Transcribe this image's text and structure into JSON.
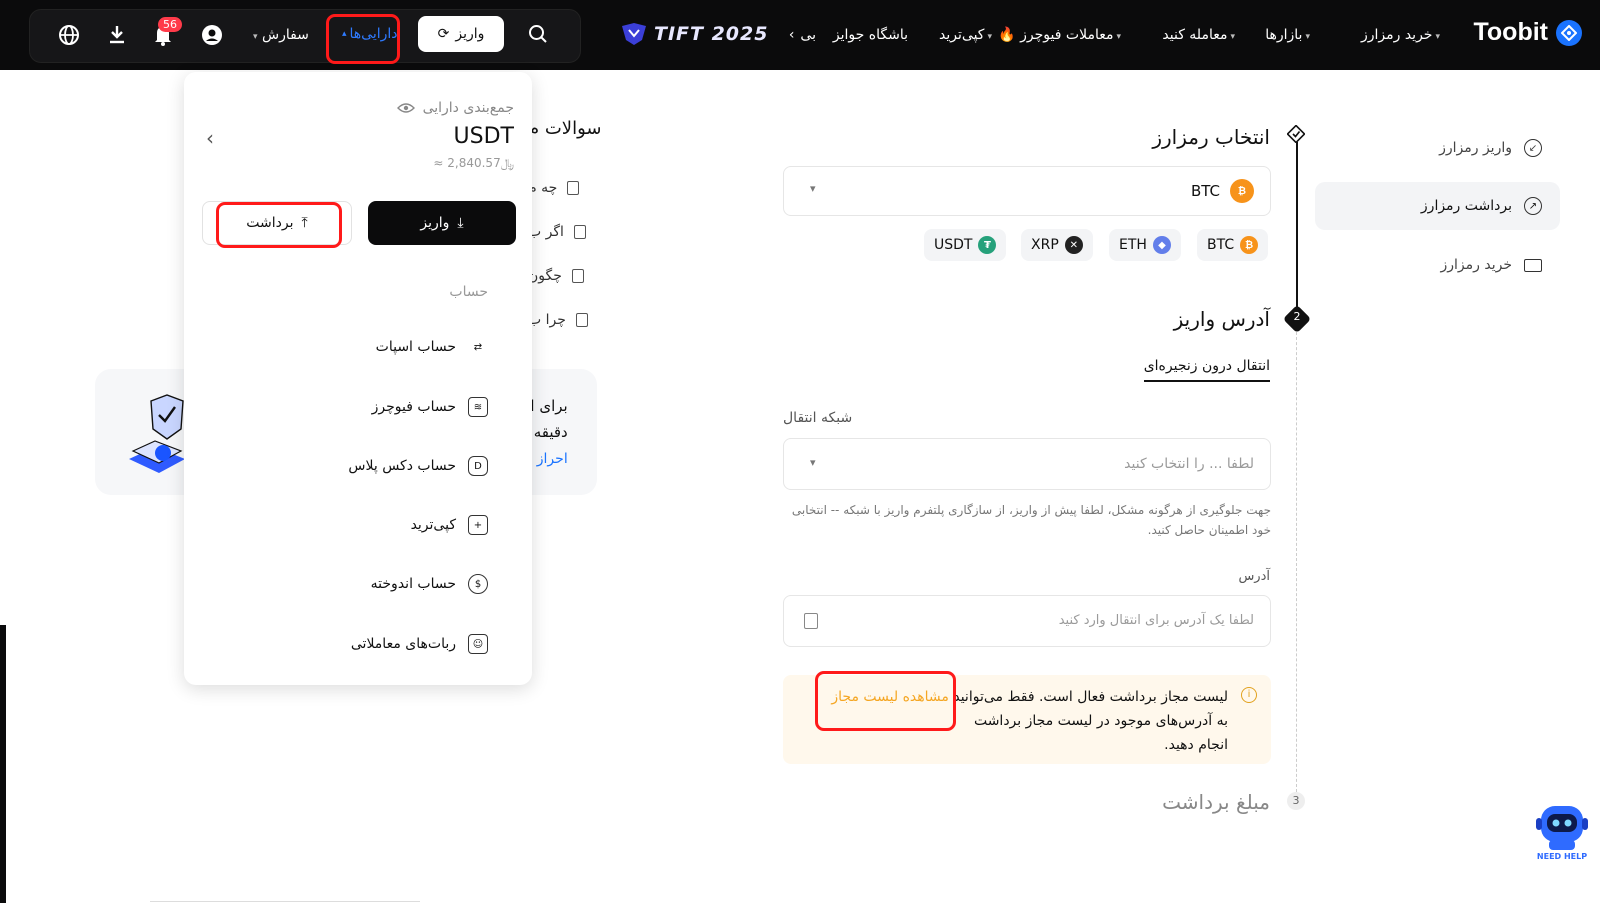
{
  "header": {
    "brand": "Toobit",
    "nav": [
      "خرید رمزارز",
      "بازارها",
      "معامله کنید",
      "معاملات فیوچرز",
      "کپی‌ترید",
      "باشگاه جوایز",
      "بی"
    ],
    "promo": "TIFT 2025",
    "deposit_label": "واریز",
    "assets_label": "دارایی‌ها",
    "orders_label": "سفارش",
    "notifications_count": "56"
  },
  "sidebar": {
    "items": [
      {
        "label": "واریز رمزارز",
        "active": false
      },
      {
        "label": "برداشت رمزارز",
        "active": true
      },
      {
        "label": "خرید رمزارز",
        "active": false
      }
    ]
  },
  "main": {
    "step1_title": "انتخاب رمزارز",
    "selected_coin": "BTC",
    "coin_options": [
      "BTC",
      "ETH",
      "XRP",
      "USDT"
    ],
    "step2_num": "2",
    "step2_title": "آدرس واریز",
    "tab_label": "انتقال درون زنجیره‌ای",
    "network_label": "شبکه انتقال",
    "network_placeholder": "لطفا ... را انتخاب کنید",
    "network_hint": "جهت جلوگیری از هرگونه مشکل، لطفا پیش از واریز، از سازگاری پلتفرم واریز با شبکه -- انتخابی خود اطمینان حاصل کنید.",
    "address_label": "آدرس",
    "address_placeholder": "لطفا یک آدرس برای انتقال وارد کنید",
    "warning_text_1": "لیست مجاز برداشت فعال است. فقط می‌توانید",
    "warning_link": "مشاهده لیست مجاز",
    "warning_text_2": "به آدرس‌های موجود در لیست مجاز برداشت",
    "warning_text_3": "انجام دهید.",
    "step3_num": "3",
    "step3_title": "مبلغ برداشت"
  },
  "faq": {
    "title": "سوالات م",
    "items": [
      "چه م",
      "اگر ب",
      "چگون",
      "چرا ب"
    ],
    "promo_line1": "برای ا",
    "promo_line2": "دقیقه",
    "promo_link": "احراز ه"
  },
  "dropdown": {
    "summary_label": "جمع‌بندی دارایی",
    "balance": "USDT",
    "balance_fiat": "≈ ﷼2,840.57",
    "deposit_btn": "واریز",
    "withdraw_btn": "برداشت",
    "section_label": "حساب",
    "accounts": [
      "حساب اسپات",
      "حساب فیوچرز",
      "حساب دکس پلاس",
      "کپی‌ترید",
      "حساب اندوخته",
      "ربات‌های معاملاتی"
    ]
  },
  "help_bot": "NEED HELP",
  "colors": {
    "accent": "#1a73ff",
    "red": "#ff1a1a",
    "btc": "#f7931a",
    "usdt": "#26a17b",
    "eth": "#627eea",
    "link": "#f5a623"
  }
}
